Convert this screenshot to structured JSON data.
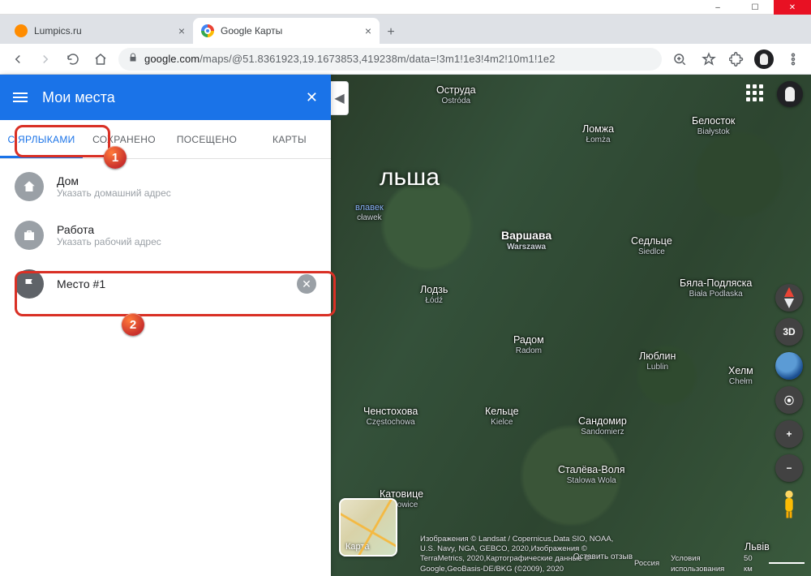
{
  "window": {
    "min": "–",
    "max": "☐",
    "close": "✕"
  },
  "browser": {
    "tabs": [
      {
        "title": "Lumpics.ru",
        "active": false,
        "favicon": "lumpics"
      },
      {
        "title": "Google Карты",
        "active": true,
        "favicon": "gico"
      }
    ],
    "newtab": "+",
    "url_host": "google.com",
    "url_path": "/maps/@51.8361923,19.1673853,419238m/data=!3m1!1e3!4m2!10m1!1e2"
  },
  "panel": {
    "title": "Мои места",
    "tabs": [
      "С ЯРЛЫКАМИ",
      "СОХРАНЕНО",
      "ПОСЕЩЕНО",
      "КАРТЫ"
    ],
    "active_tab_index": 0,
    "items": [
      {
        "icon": "home",
        "title": "Дом",
        "subtitle": "Указать домашний адрес",
        "removable": false
      },
      {
        "icon": "work",
        "title": "Работа",
        "subtitle": "Указать рабочий адрес",
        "removable": false
      },
      {
        "icon": "flag",
        "title": "Место #1",
        "subtitle": "",
        "removable": true
      }
    ]
  },
  "map": {
    "country": "льша",
    "layer_label": "Карта",
    "controls": {
      "3d": "3D",
      "plus": "+",
      "minus": "−",
      "target": "⦿"
    },
    "cities": {
      "ostroda": {
        "name": "Оструда",
        "lat": "Ostróda"
      },
      "lomza": {
        "name": "Ломжа",
        "lat": "Łomża"
      },
      "bialystok": {
        "name": "Белосток",
        "lat": "Białystok"
      },
      "wloclawek": {
        "name": "влавек",
        "lat": "cławek"
      },
      "warszawa": {
        "name": "Варшава",
        "lat": "Warszawa"
      },
      "siedlce": {
        "name": "Седльце",
        "lat": "Siedlce"
      },
      "lodz": {
        "name": "Лодзь",
        "lat": "Łódź"
      },
      "biala": {
        "name": "Бяла-Подляска",
        "lat": "Biała Podlaska"
      },
      "radom": {
        "name": "Радом",
        "lat": "Radom"
      },
      "lublin": {
        "name": "Люблин",
        "lat": "Lublin"
      },
      "chelm": {
        "name": "Хелм",
        "lat": "Chełm"
      },
      "czestochowa": {
        "name": "Ченстохова",
        "lat": "Częstochowa"
      },
      "kielce": {
        "name": "Кельце",
        "lat": "Kielce"
      },
      "sandomierz": {
        "name": "Сандомир",
        "lat": "Sandomierz"
      },
      "stalowa": {
        "name": "Сталёва-Воля",
        "lat": "Stalowa Wola"
      },
      "katowice": {
        "name": "Катовице",
        "lat": "Katowice"
      },
      "lviv": {
        "name": "Львів",
        "lat": ""
      }
    },
    "attribution_left": "Изображения © Landsat / Copernicus,Data SIO, NOAA, U.S. Navy, NGA, GEBCO, 2020,Изображения © TerraMetrics, 2020,Картографические данные © Google,GeoBasis-DE/BKG (©2009), 2020",
    "attribution_country": "Россия",
    "attribution_terms": "Условия использования",
    "attribution_feedback": "Оставить отзыв",
    "scale": "50 км"
  },
  "callouts": {
    "c1": "1",
    "c2": "2"
  }
}
